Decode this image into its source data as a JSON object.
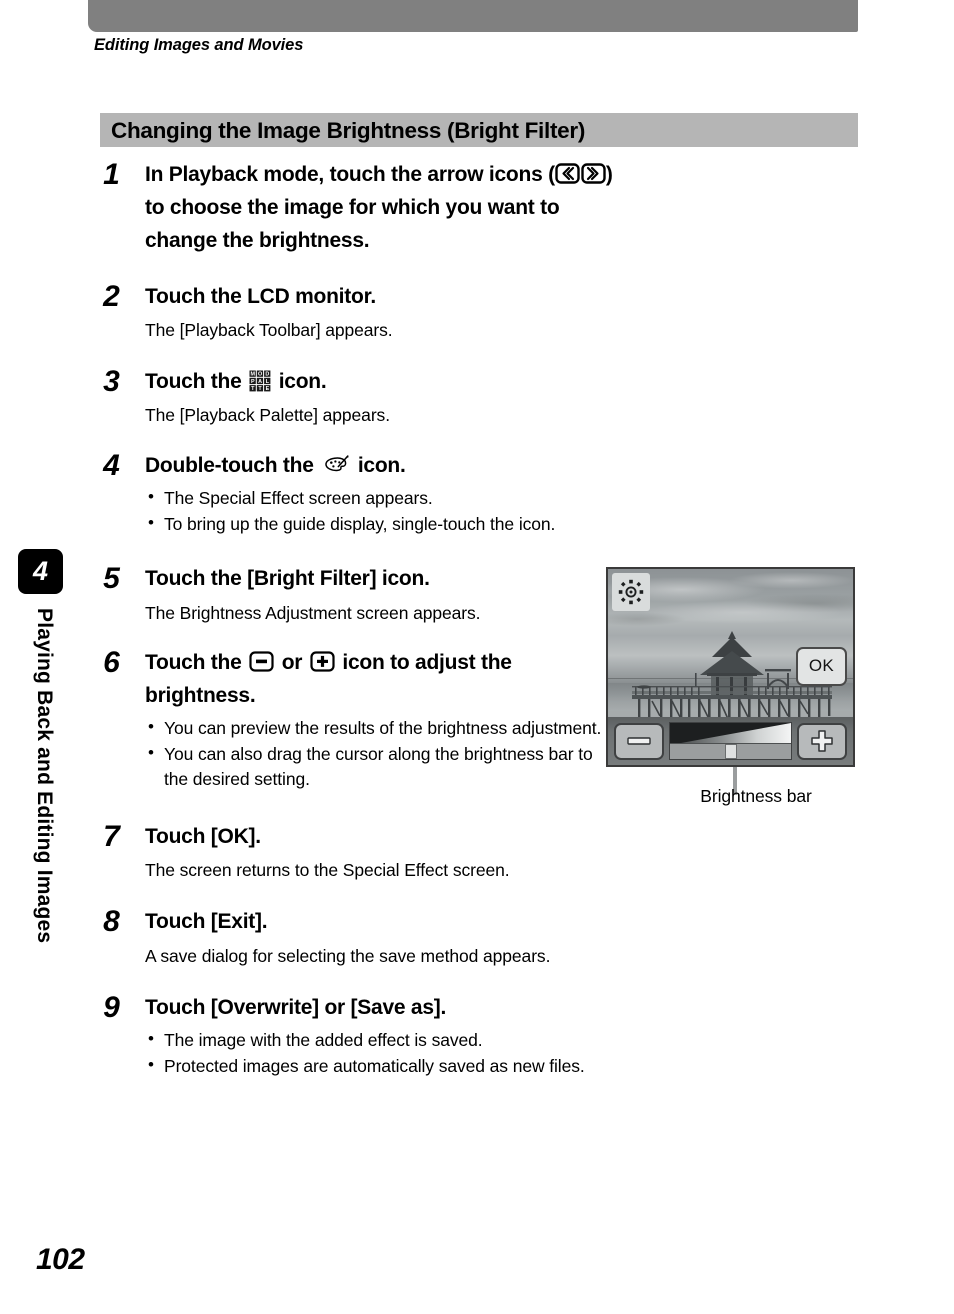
{
  "running_head": "Editing Images and Movies",
  "section_heading": "Changing the Image Brightness (Bright Filter)",
  "chapter": {
    "number": "4",
    "label": "Playing Back and Editing Images"
  },
  "page_number": "102",
  "steps": [
    {
      "num": "1",
      "title_before": "In Playback mode, touch the arrow icons (",
      "title_after": ") to choose the image for which you want to change the brightness.",
      "icons": [
        "arrow-left-icon",
        "arrow-right-icon"
      ]
    },
    {
      "num": "2",
      "title": "Touch the LCD monitor.",
      "desc": "The [Playback Toolbar] appears."
    },
    {
      "num": "3",
      "title_before": "Touch the ",
      "title_after": " icon.",
      "icon": "mode-palette-icon",
      "desc": "The [Playback Palette] appears."
    },
    {
      "num": "4",
      "title_before": "Double-touch the ",
      "title_after": " icon.",
      "icon": "paint-palette-icon",
      "bullets": [
        "The Special Effect screen appears.",
        "To bring up the guide display, single-touch the icon."
      ]
    },
    {
      "num": "5",
      "title": "Touch the [Bright Filter] icon.",
      "desc": "The Brightness Adjustment screen appears."
    },
    {
      "num": "6",
      "title_before": "Touch the ",
      "title_mid": " or ",
      "title_after": " icon to adjust the brightness.",
      "icons": [
        "minus-icon",
        "plus-icon"
      ],
      "bullets": [
        "You can preview the results of the brightness adjustment.",
        "You can also drag the cursor along the brightness bar to the desired setting."
      ]
    },
    {
      "num": "7",
      "title": "Touch [OK].",
      "desc": "The screen returns to the Special Effect screen."
    },
    {
      "num": "8",
      "title": "Touch [Exit].",
      "desc": "A save dialog for selecting the save method appears."
    },
    {
      "num": "9",
      "title": "Touch [Overwrite] or [Save as].",
      "bullets": [
        "The image with the added effect is saved.",
        "Protected images are automatically saved as new files."
      ]
    }
  ],
  "figure": {
    "caption": "Brightness bar",
    "ok_label": "OK",
    "brightness_icon": "sun-brightness-icon",
    "minus_button": "minus-button",
    "plus_button": "plus-button",
    "photo_subject": "pier with pavilion over water (grayscale)",
    "slider_position_percent": 50
  },
  "colors": {
    "top_bar": "#808080",
    "section_bar": "#b5b5b5",
    "chapter_tab": "#000000",
    "text": "#000000"
  }
}
